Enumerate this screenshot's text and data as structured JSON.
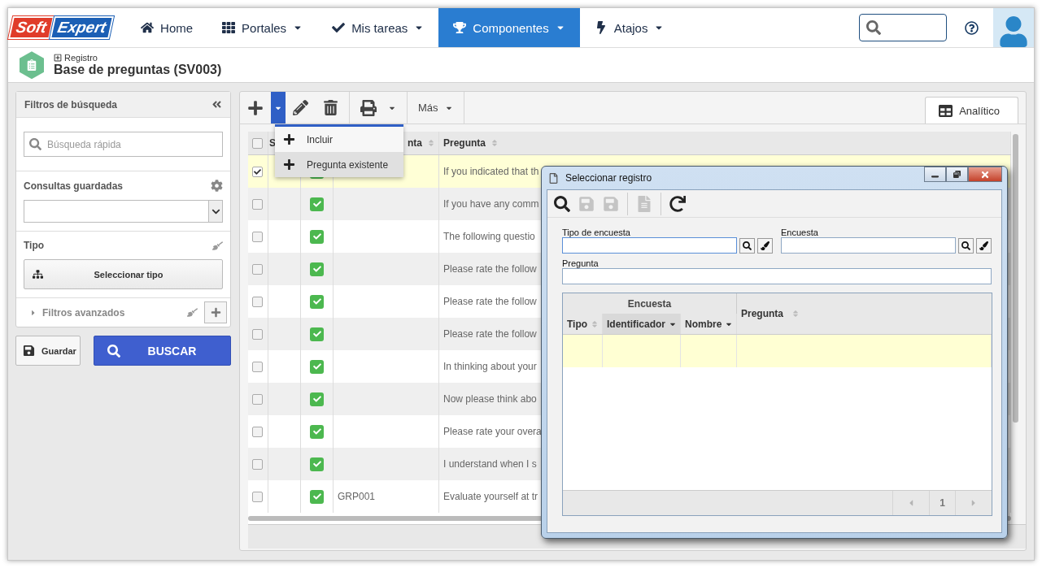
{
  "logo": [
    {
      "text": "Soft",
      "color": "#e03c2a"
    },
    {
      "text": "Expert",
      "color": "#1b5fb5"
    }
  ],
  "nav": [
    {
      "label": "Home",
      "dropdown": false,
      "selected": false
    },
    {
      "label": "Portales",
      "dropdown": true,
      "selected": false
    },
    {
      "label": "Mis tareas",
      "dropdown": true,
      "selected": false
    },
    {
      "label": "Componentes",
      "dropdown": true,
      "selected": true
    },
    {
      "label": "Atajos",
      "dropdown": true,
      "selected": false
    }
  ],
  "header": {
    "breadcrumb": "Registro",
    "title": "Base de preguntas (SV003)"
  },
  "filters": {
    "title": "Filtros de búsqueda",
    "quick_search": {
      "placeholder": "Búsqueda rápida"
    },
    "saved_queries": {
      "label": "Consultas guardadas"
    },
    "type": {
      "label": "Tipo",
      "button": "Seleccionar tipo"
    },
    "advanced": {
      "label": "Filtros avanzados",
      "expanded": false
    }
  },
  "actions": [
    {
      "kind": "save",
      "label": "Guardar"
    },
    {
      "kind": "search",
      "label": "BUSCAR"
    }
  ],
  "toolbar": {
    "add_menu_expanded": true,
    "more": "Más",
    "view_tab": {
      "label": "Analítico",
      "selected": true
    }
  },
  "add_menu": [
    {
      "label": "Incluir",
      "selected": false
    },
    {
      "label": "Pregunta existente",
      "selected": true
    }
  ],
  "table": {
    "all_checked": false,
    "columns": [
      "S",
      "nta",
      "Pregunta"
    ],
    "rows": [
      {
        "checked": true,
        "selected": true,
        "active": true,
        "question": "If you indicated that th"
      },
      {
        "checked": false,
        "selected": false,
        "active": true,
        "question": "If you have any comm"
      },
      {
        "checked": false,
        "selected": false,
        "active": true,
        "question": "The following questio"
      },
      {
        "checked": false,
        "selected": false,
        "active": true,
        "question": "Please rate the follow"
      },
      {
        "checked": false,
        "selected": false,
        "active": true,
        "question": "Please rate the follow"
      },
      {
        "checked": false,
        "selected": false,
        "active": true,
        "question": "Please rate the follow"
      },
      {
        "checked": false,
        "selected": false,
        "active": true,
        "question": "In thinking about your"
      },
      {
        "checked": false,
        "selected": false,
        "active": true,
        "question": "Now please think abo"
      },
      {
        "checked": false,
        "selected": false,
        "active": true,
        "question": "Please rate your overa"
      },
      {
        "checked": false,
        "selected": false,
        "active": true,
        "question": "I understand when I s"
      },
      {
        "checked": false,
        "selected": false,
        "active": true,
        "code": "GRP001",
        "question": "Evaluate yourself at tr"
      }
    ]
  },
  "dialog": {
    "title": "Seleccionar registro",
    "toolbar": [
      {
        "disabled": false
      },
      {
        "disabled": true
      },
      {
        "disabled": true
      },
      {
        "disabled": true
      },
      {
        "disabled": false
      }
    ],
    "fields": [
      {
        "label": "Tipo de encuesta"
      },
      {
        "label": "Encuesta"
      },
      {
        "label": "Pregunta"
      }
    ],
    "grid": {
      "group": "Encuesta",
      "columns": [
        {
          "label": "Tipo",
          "sorted": false,
          "selected": false
        },
        {
          "label": "Identificador",
          "sorted": true,
          "selected": true
        },
        {
          "label": "Nombre",
          "sorted": true,
          "selected": false
        }
      ],
      "last_column": {
        "label": "Pregunta",
        "sorted": false
      },
      "rows": [
        {
          "selected": true
        }
      ],
      "pager": {
        "page": "1",
        "prev_disabled": true,
        "next_disabled": true
      }
    }
  }
}
